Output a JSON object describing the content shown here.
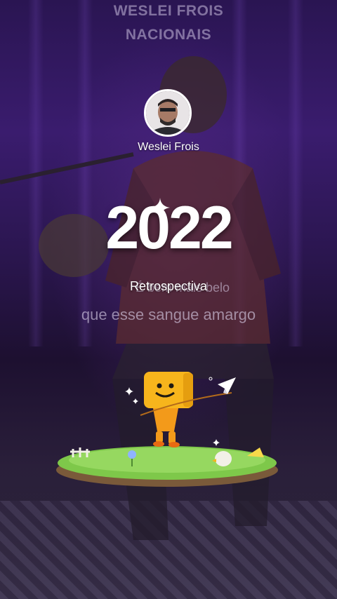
{
  "video": {
    "song_title_line1": "WESLEI FROIS",
    "song_title_line2": "NACIONAIS",
    "lyric_line1": "É bem mais belo",
    "lyric_line2": "que esse sangue amargo"
  },
  "profile": {
    "username": "Weslei  Frois"
  },
  "recap": {
    "year": "2022",
    "label": "Retrospectiva"
  },
  "colors": {
    "background": "#2a1552",
    "text": "#ffffff",
    "mascot": "#f7b51c",
    "grass": "#7ec84a"
  },
  "icons": [
    "sparkle-icon",
    "paper-plane-icon",
    "mascot-character",
    "grass-island"
  ]
}
